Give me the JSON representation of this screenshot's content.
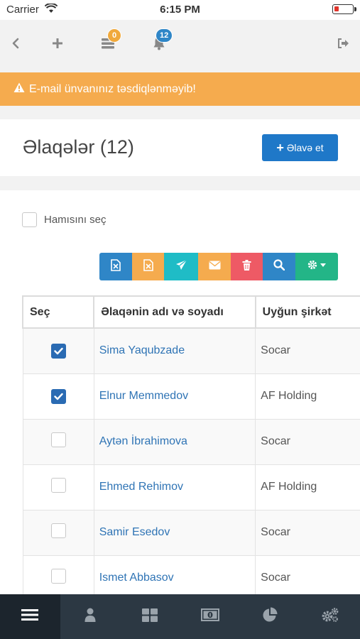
{
  "status_bar": {
    "carrier": "Carrier",
    "time": "6:15 PM"
  },
  "top_nav": {
    "messages_badge": "0",
    "notifications_badge": "12",
    "icons": [
      "back-icon",
      "plus-icon",
      "messages-icon",
      "bell-icon",
      "sign-out-icon"
    ]
  },
  "alert": {
    "text": "E-mail ünvanınız təsdiqlənməyib!",
    "color": "#f5ab4e"
  },
  "page": {
    "title": "Əlaqələr (12)",
    "add_button_label": "Əlavə et"
  },
  "select_all_label": "Hamısını seç",
  "toolbar": {
    "buttons": [
      {
        "icon": "excel-export-icon",
        "color": "#2f86c7"
      },
      {
        "icon": "excel-import-icon",
        "color": "#f5ab4e"
      },
      {
        "icon": "send-icon",
        "color": "#1fbcc6"
      },
      {
        "icon": "envelope-icon",
        "color": "#f5ab4e"
      },
      {
        "icon": "trash-icon",
        "color": "#ee5a65"
      },
      {
        "icon": "search-icon",
        "color": "#2f86c7"
      },
      {
        "icon": "settings-dropdown-icon",
        "color": "#23b587"
      }
    ]
  },
  "table": {
    "headers": [
      "Seç",
      "Əlaqənin adı və soyadı",
      "Uyğun şirkət"
    ],
    "rows": [
      {
        "checked": true,
        "name": "Sima Yaqubzade",
        "company": "Socar"
      },
      {
        "checked": true,
        "name": "Elnur Memmedov",
        "company": "AF Holding"
      },
      {
        "checked": false,
        "name": "Aytən İbrahimova",
        "company": "Socar"
      },
      {
        "checked": false,
        "name": "Ehmed Rehimov",
        "company": "AF Holding"
      },
      {
        "checked": false,
        "name": "Samir Esedov",
        "company": "Socar"
      },
      {
        "checked": false,
        "name": "Ismet Abbasov",
        "company": "Socar"
      }
    ]
  },
  "tab_bar": {
    "tabs": [
      {
        "icon": "menu-icon",
        "active": true
      },
      {
        "icon": "user-icon",
        "active": false
      },
      {
        "icon": "grid-icon",
        "active": false
      },
      {
        "icon": "money-icon",
        "active": false
      },
      {
        "icon": "pie-chart-icon",
        "active": false
      },
      {
        "icon": "gears-icon",
        "active": false
      }
    ]
  }
}
